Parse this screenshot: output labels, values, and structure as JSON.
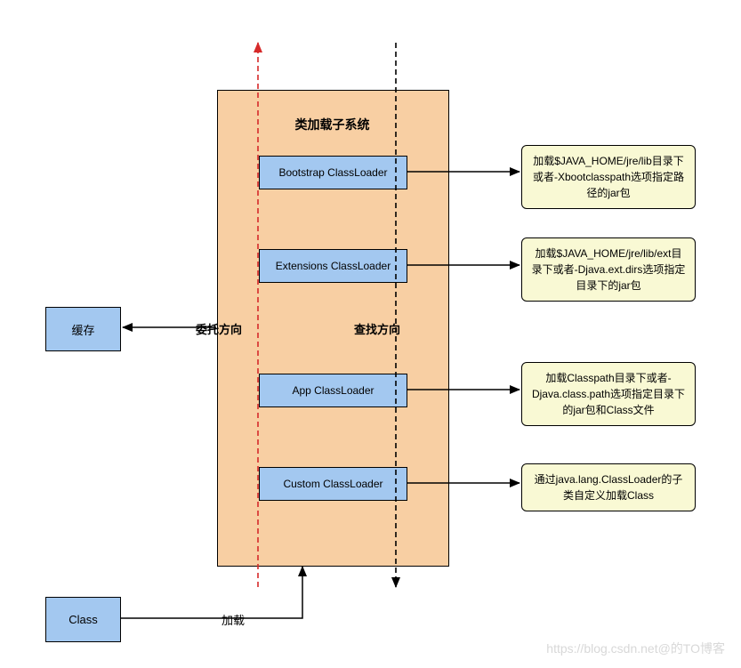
{
  "main": {
    "title": "类加载子系统",
    "loaders": [
      {
        "label": "Bootstrap ClassLoader",
        "desc": "加载$JAVA_HOME/jre/lib目录下或者-Xbootclasspath选项指定路径的jar包"
      },
      {
        "label": "Extensions ClassLoader",
        "desc": "加载$JAVA_HOME/jre/lib/ext目录下或者-Djava.ext.dirs选项指定目录下的jar包"
      },
      {
        "label": "App ClassLoader",
        "desc": "加载Classpath目录下或者-Djava.class.path选项指定目录下的jar包和Class文件"
      },
      {
        "label": "Custom ClassLoader",
        "desc": "通过java.lang.ClassLoader的子类自定义加载Class"
      }
    ]
  },
  "cache": {
    "label": "缓存"
  },
  "classBox": {
    "label": "Class"
  },
  "arrows": {
    "delegate": "委托方向",
    "lookup": "查找方向",
    "load": "加载"
  },
  "watermark": "https://blog.csdn.net@的TO博客"
}
